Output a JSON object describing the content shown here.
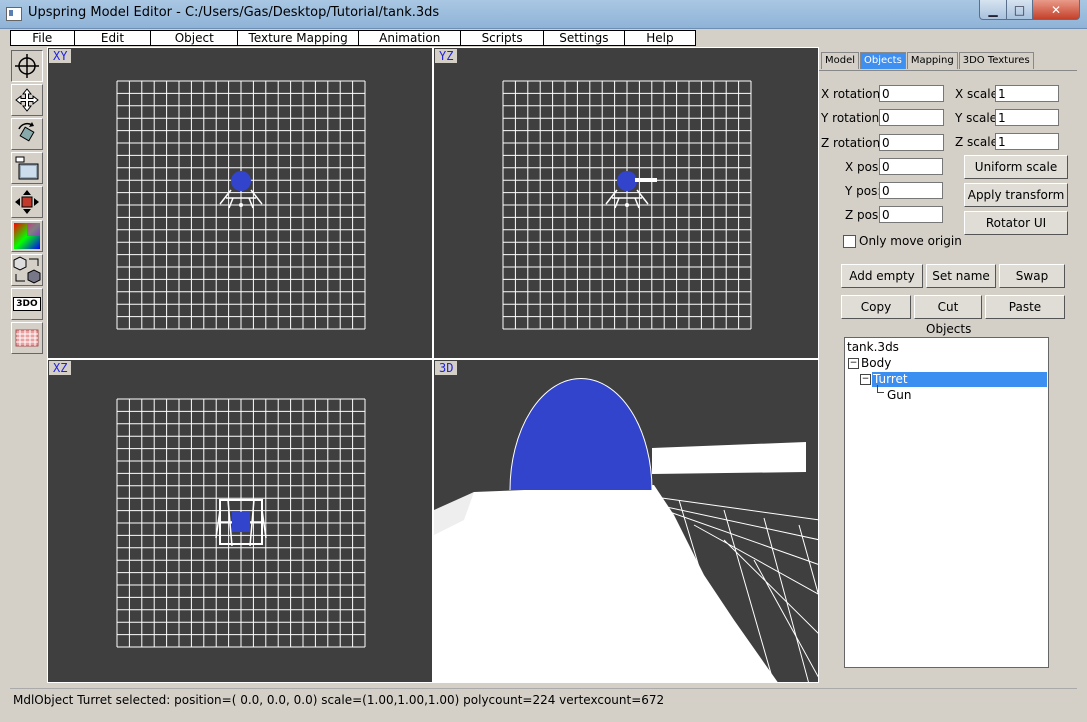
{
  "window": {
    "title": "Upspring Model Editor - C:/Users/Gas/Desktop/Tutorial/tank.3ds",
    "minimize": "▁",
    "maximize": "□",
    "close": "✕"
  },
  "menu": [
    "File",
    "Edit",
    "Object",
    "Texture Mapping",
    "Animation",
    "Scripts",
    "Settings",
    "Help"
  ],
  "viewports": {
    "xy": "XY",
    "yz": "YZ",
    "xz": "XZ",
    "persp": "3D"
  },
  "tools": [
    "crosshair-icon",
    "move-icon",
    "rotate-icon",
    "texture-icon",
    "scale-icon",
    "color-icon",
    "swap-objects-icon",
    "3do-icon",
    "texture-swatch-icon"
  ],
  "tool_3do_label": "3DO",
  "tabs": [
    "Model",
    "Objects",
    "Mapping",
    "3DO Textures"
  ],
  "active_tab": "Objects",
  "transform": {
    "x_rotation_label": "X rotation:",
    "x_rotation": "0",
    "y_rotation_label": "Y rotation:",
    "y_rotation": "0",
    "z_rotation_label": "Z rotation:",
    "z_rotation": "0",
    "x_scale_label": "X scale",
    "x_scale": "1",
    "y_scale_label": "Y scale",
    "y_scale": "1",
    "z_scale_label": "Z scale",
    "z_scale": "1",
    "x_pos_label": "X pos:",
    "x_pos": "0",
    "y_pos_label": "Y pos:",
    "y_pos": "0",
    "z_pos_label": "Z pos:",
    "z_pos": "0"
  },
  "buttons": {
    "uniform_scale": "Uniform scale",
    "apply_transform": "Apply transform",
    "rotator_ui": "Rotator UI",
    "add_empty": "Add empty",
    "set_name": "Set name",
    "swap": "Swap",
    "copy": "Copy",
    "cut": "Cut",
    "paste": "Paste"
  },
  "only_move_origin": "Only move origin",
  "objects_header": "Objects",
  "tree": {
    "root": "tank.3ds",
    "body": "Body",
    "turret": "Turret",
    "gun": "Gun"
  },
  "status": "MdlObject Turret selected: position=( 0.0, 0.0, 0.0) scale=(1.00,1.00,1.00) polycount=224 vertexcount=672",
  "colors": {
    "viewport_bg": "#3f3f3f",
    "selection": "#3b8ff0",
    "axis_label": "#2222dd"
  }
}
